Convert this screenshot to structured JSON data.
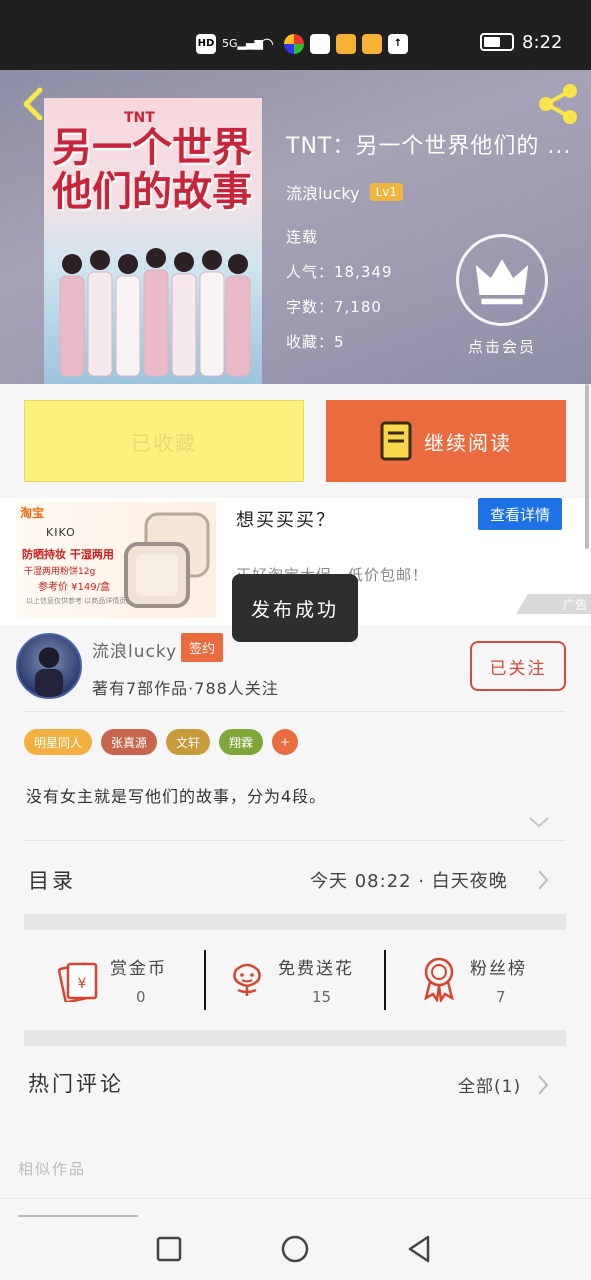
{
  "status_bar": {
    "time": "8:22",
    "signal": "5G",
    "hd": "HD"
  },
  "header": {
    "back_icon": "chevron-left-icon",
    "share_icon": "share-icon",
    "cover": {
      "tnt": "TNT",
      "title_line1": "另一个世界",
      "title_line2": "他们的故事"
    },
    "title": "TNT：另一个世界他们的 ...",
    "author": "流浪lucky",
    "level": "Lv1",
    "status": "连载",
    "popularity": "人气：18,349",
    "word_count": "字数：7,180",
    "collections": "收藏：5",
    "vip_icon": "crown-icon",
    "vip_label": "点击会员"
  },
  "actions": {
    "collected_label": "已收藏",
    "continue_label": "继续阅读",
    "book_icon": "book-icon"
  },
  "ad": {
    "taobao": "淘宝",
    "brand": "KIKO",
    "headline": "防晒持妆 干湿两用",
    "subline": "干湿两用粉饼12g",
    "price": "参考价 ¥149/盒",
    "fine_print": "以上信息仅供参考 以商品详情页为准",
    "title": "想买买买？",
    "detail_button": "查看详情",
    "desc": "正好淘宝大促，低价包邮！",
    "tag": "广告"
  },
  "toast": "发布成功",
  "author_section": {
    "name": "流浪lucky",
    "signed": "签约",
    "works": "著有7部作品·788人关注",
    "follow_label": "已关注",
    "tags": [
      {
        "label": "明星同人",
        "color": "#f2b041"
      },
      {
        "label": "张真源",
        "color": "#c5654b"
      },
      {
        "label": "文轩",
        "color": "#c99a3c"
      },
      {
        "label": "翔霖",
        "color": "#7fa73c"
      },
      {
        "label": "+",
        "color": "#ea6c3e"
      }
    ],
    "summary": "没有女主就是写他们的故事，分为4段。",
    "toc_label": "目录",
    "toc_latest": "今天 08:22 · 白天夜晚",
    "stats": [
      {
        "icon": "red-envelope-icon",
        "label": "赏金币",
        "value": "0"
      },
      {
        "icon": "flower-icon",
        "label": "免费送花",
        "value": "15"
      },
      {
        "icon": "medal-icon",
        "label": "粉丝榜",
        "value": "7"
      }
    ]
  },
  "hot_comments": {
    "title": "热门评论",
    "all_label": "全部(1)",
    "similar_label": "相似作品"
  },
  "colors": {
    "accent": "#ea6c3e",
    "yellow": "#fbf27e",
    "blue": "#1f72e6",
    "follow": "#d84b3a",
    "stat_icon": "#d8452f"
  }
}
